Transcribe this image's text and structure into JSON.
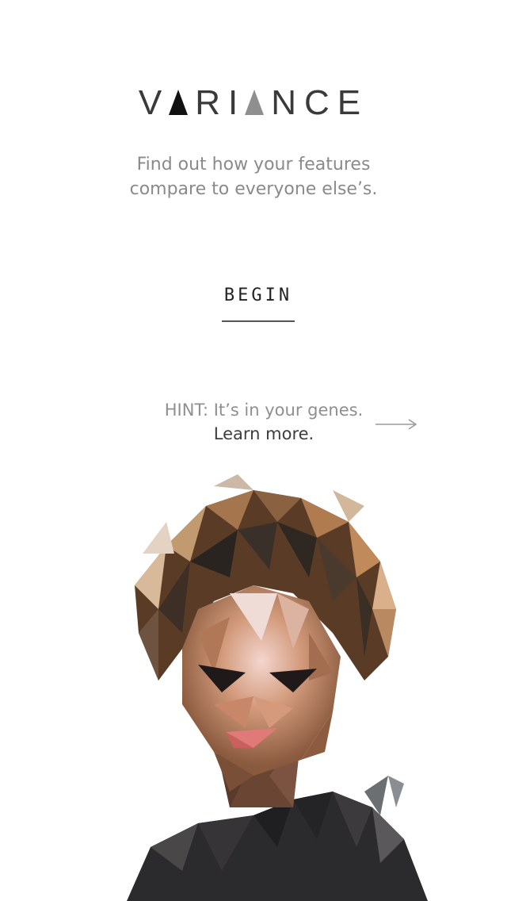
{
  "app": {
    "logo": {
      "letters_before": "V",
      "letters_middle": "RI",
      "letters_after": "NCE"
    },
    "tagline_line1": "Find out how your features",
    "tagline_line2": "compare to everyone else’s."
  },
  "actions": {
    "begin_label": "BEGIN"
  },
  "hint": {
    "text": "HINT: It’s in your genes.",
    "learn_more": "Learn more.",
    "arrow_icon": "arrow-right-icon"
  },
  "colors": {
    "background": "#ffffff",
    "text_dark": "#3a3a3a",
    "text_muted": "#8a8a8a",
    "triangle_dark": "#111111",
    "triangle_light": "#8f8f8f"
  },
  "illustration": {
    "type": "low-poly-portrait"
  }
}
